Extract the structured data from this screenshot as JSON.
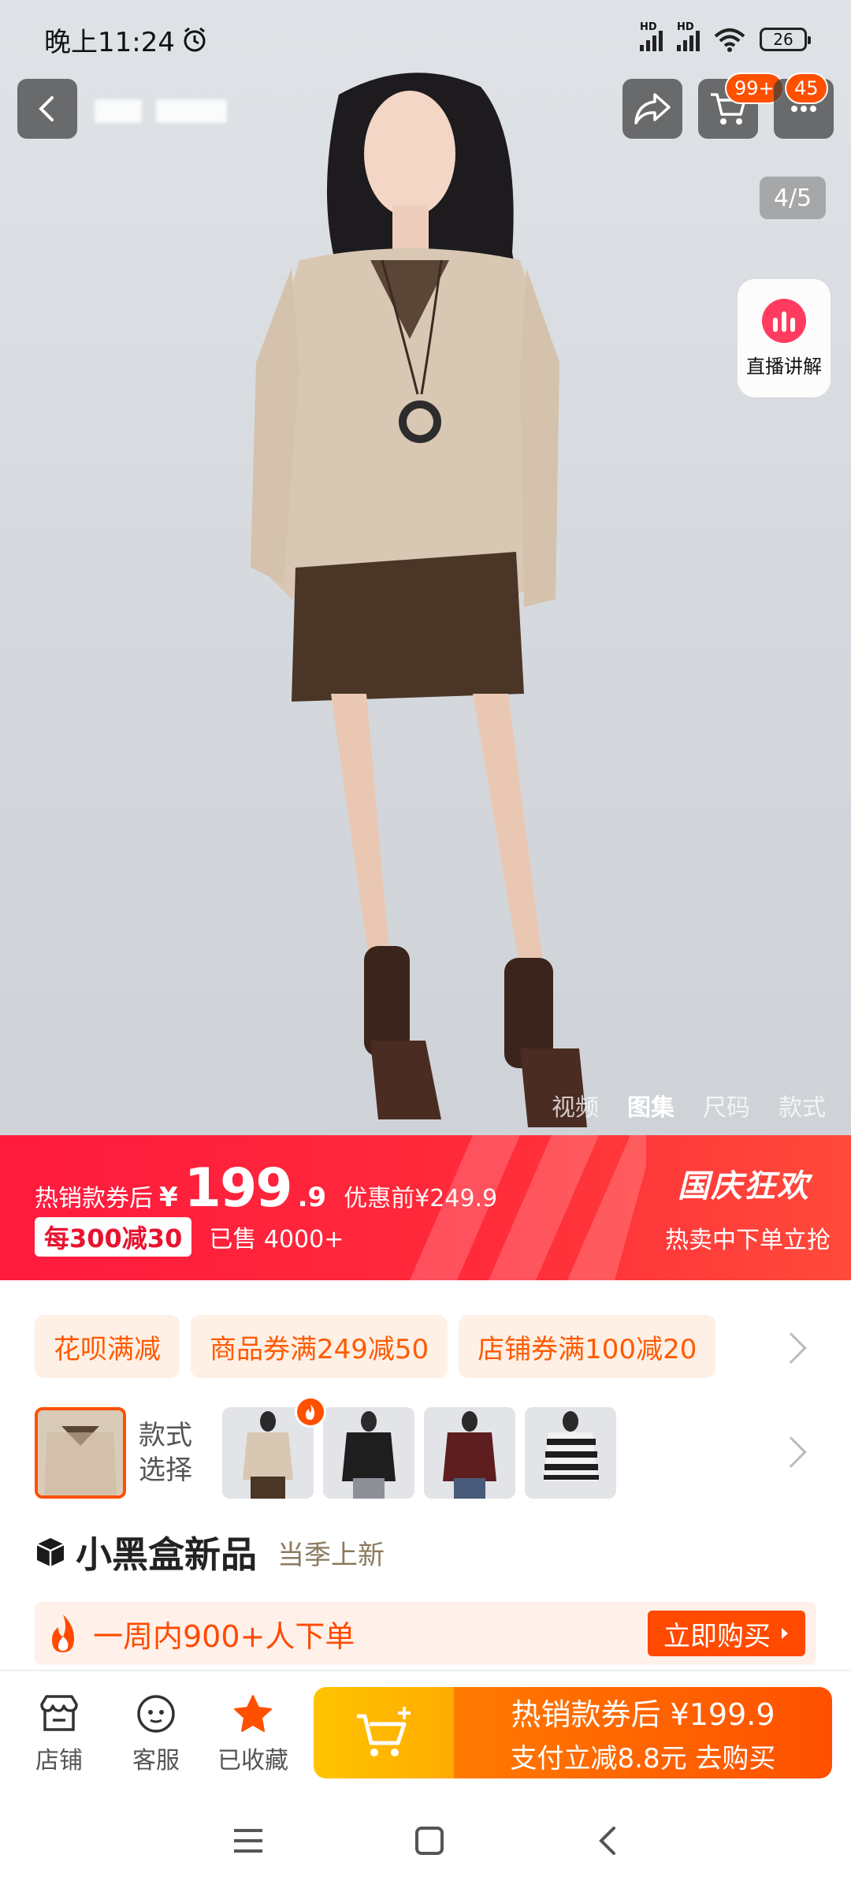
{
  "status_bar": {
    "time": "晚上11:24",
    "signal1": "HD",
    "signal2": "HD",
    "battery": "26"
  },
  "top_nav": {
    "cart_badge": "99+",
    "more_badge": "45",
    "page_counter": "4/5",
    "live_label": "直播讲解"
  },
  "media_tabs": [
    "视频",
    "图集",
    "尺码",
    "款式"
  ],
  "price": {
    "prefix": "热销款券后",
    "yen": "¥",
    "main": "199",
    "decimal": ".9",
    "before": "优惠前¥249.9",
    "promo": "每300减30",
    "sold": "已售 4000+",
    "festival_title": "国庆狂欢",
    "festival_sub": "热卖中下单立抢"
  },
  "coupons": [
    "花呗满减",
    "商品券满249减50",
    "店铺券满100减20"
  ],
  "style_select": {
    "label": "款式\n选择",
    "label1": "款式",
    "label2": "选择"
  },
  "brand": {
    "name": "小黑盒新品",
    "sub": "当季上新"
  },
  "order_bar": {
    "text": "一周内900+人下单",
    "button": "立即购买"
  },
  "bottom_bar": {
    "shop": "店铺",
    "service": "客服",
    "favorite": "已收藏",
    "buy_line1": "热销款券后 ¥199.9",
    "buy_line2": "支付立减8.8元 去购买"
  },
  "colors": {
    "accent": "#ff5000",
    "price_red": "#ff1a3e",
    "coupon_bg": "#fff0e6"
  }
}
